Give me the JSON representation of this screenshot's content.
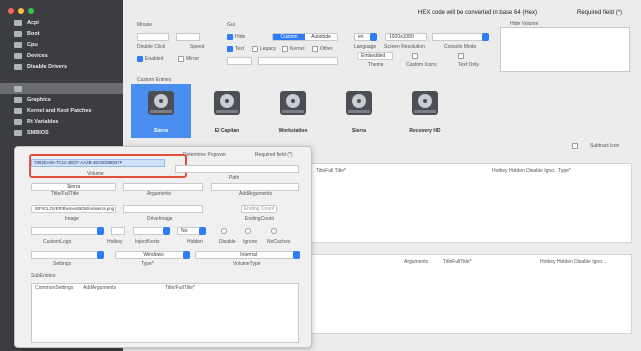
{
  "sidebar": {
    "title": "",
    "items": [
      {
        "label": "Acpi",
        "selected": false
      },
      {
        "label": "Boot",
        "selected": false
      },
      {
        "label": "Cpu",
        "selected": false
      },
      {
        "label": "Devices",
        "selected": false
      },
      {
        "label": "Disable Drivers",
        "selected": false
      },
      {
        "label": "",
        "selected": true
      },
      {
        "label": "Graphics",
        "selected": false
      },
      {
        "label": "Kernel and Kext Patches",
        "selected": false
      },
      {
        "label": "Rt Variables",
        "selected": false
      },
      {
        "label": "SMBIOS",
        "selected": false
      }
    ]
  },
  "header": {
    "hex_note": "HEX code will be converted in base 64 (Hex)",
    "required": "Required field (*)"
  },
  "mouse": {
    "title": "Mouse",
    "double_click": "Double Click",
    "speed": "Speed",
    "enabled": "Enabled",
    "mirror": "Mirror"
  },
  "gui": {
    "title": "Gui",
    "hide_label": "Hide",
    "seg": [
      "Custom",
      "Autohide"
    ],
    "text": "Text",
    "legacy": "Legacy",
    "kernel": "Kernel",
    "other": "Other",
    "language": "Language",
    "language_value": "en",
    "resolution": "Screen Resolution",
    "resolution_value": "1920x1080",
    "console_mode": "Console Mode",
    "theme": "Theme",
    "theme_value": "Embedded",
    "custom_icons": "Custom Icons",
    "text_only": "Text Only",
    "hide_volume": "Hide Volume"
  },
  "custom_entries_label": "Custom Entries",
  "drives": [
    {
      "label": "Sierra",
      "selected": true
    },
    {
      "label": "El Capitan",
      "selected": false
    },
    {
      "label": "Workstation",
      "selected": false
    },
    {
      "label": "Sierra",
      "selected": false
    },
    {
      "label": "Recovery HD",
      "selected": false
    }
  ],
  "table1": {
    "type_label": "TitleFull Title*",
    "cols": "Hotkey  Hidden  Disable  Igno..  Type*"
  },
  "table2": {
    "arguments": "Arguments",
    "type_label": "TitleFullTitle*",
    "cols": "Hotkey  Hidden  Disable  Igno..."
  },
  "subtract_icon_label": "Subtract Icon",
  "popover": {
    "header": "Determine Popover",
    "required": "Required field (*)",
    "guid": "7992EA56-7C11-4BCF-AA3B-4E03D88EB7F",
    "volume_label": "Volume",
    "path_label": "Path",
    "title_label": "Sierra",
    "title_full": "Title/FullTitle",
    "arguments_label": "Arguments",
    "add_arguments_label": "AddArguments",
    "image_path": "\\EFI\\CLOVER\\themes\\BGM\\os\\sierra.png",
    "image_label": "Image",
    "drive_image_label": "DriveImage",
    "ending_label": "EndingCount",
    "ending_value": "Ending Count",
    "custom_logo": "CustomLogo",
    "hotkey": "Hotkey",
    "injectkexts": "InjectKexts",
    "hidden": "Hidden",
    "disable": "Disable",
    "ignore": "Ignore",
    "no_caches": "NoCaches",
    "no_value": "No",
    "settings_label": "Settings",
    "type_label": "Type*",
    "type_value": "Windows",
    "volume_type_label": "VolumeType",
    "volume_type_value": "Internal",
    "sub_entries_label": "SubEntries",
    "sub_row": [
      "CommonSettings",
      "AddArguments",
      "Title/FullTitle*"
    ]
  }
}
